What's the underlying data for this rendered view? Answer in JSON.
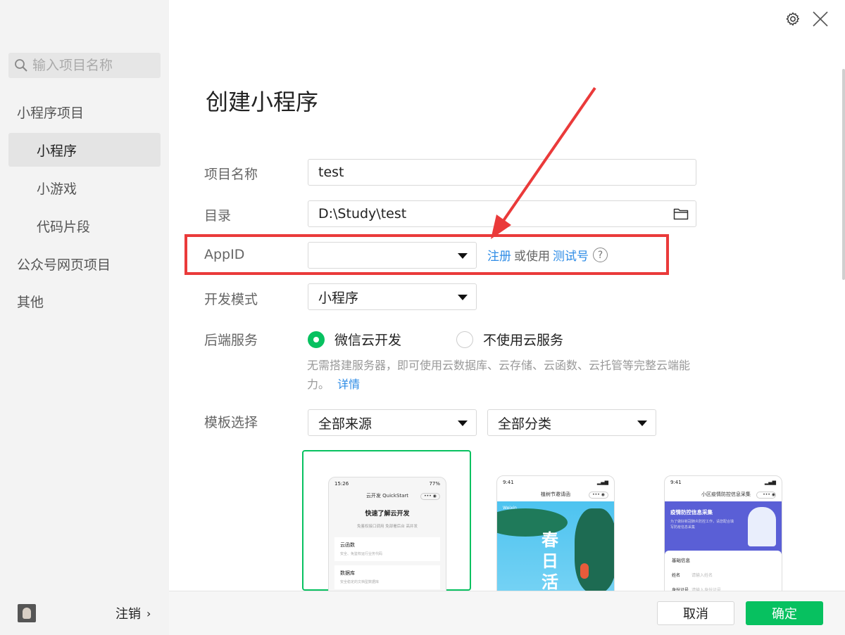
{
  "sidebar": {
    "search_placeholder": "输入项目名称",
    "items": [
      {
        "label": "小程序项目"
      },
      {
        "label": "小程序"
      },
      {
        "label": "小游戏"
      },
      {
        "label": "代码片段"
      },
      {
        "label": "公众号网页项目"
      },
      {
        "label": "其他"
      }
    ],
    "logout_label": "注销"
  },
  "form": {
    "title": "创建小程序",
    "project_name": {
      "label": "项目名称",
      "value": "test"
    },
    "directory": {
      "label": "目录",
      "value": "D:\\Study\\test"
    },
    "appid": {
      "label": "AppID",
      "value": "",
      "register_link": "注册",
      "or_use": "或使用",
      "test_link": "测试号",
      "help": "?"
    },
    "dev_mode": {
      "label": "开发模式",
      "value": "小程序"
    },
    "backend": {
      "label": "后端服务",
      "options": [
        {
          "label": "微信云开发",
          "selected": true
        },
        {
          "label": "不使用云服务",
          "selected": false
        }
      ],
      "description": "无需搭建服务器，即可使用云数据库、云存储、云函数、云托管等完整云端能力。",
      "detail_link": "详情"
    },
    "template": {
      "label": "模板选择",
      "source": "全部来源",
      "category": "全部分类"
    }
  },
  "templates": [
    {
      "time": "15:26",
      "battery": "77%",
      "header": "云开发 QuickStart",
      "heading": "快速了解云开发",
      "sub": "免鉴权接口调用 免部署后台 高并发",
      "rows": [
        {
          "title": "云函数",
          "desc": "安全、免鉴权运行业务代码"
        },
        {
          "title": "数据库",
          "desc": "安全稳定的文档型数据库"
        }
      ]
    },
    {
      "time": "9:41",
      "header": "植树节邀请函",
      "brand": "Weixin",
      "poster": "春日活"
    },
    {
      "time": "9:41",
      "header": "小区疫情防控信息采集",
      "banner_title": "疫情防控信息采集",
      "banner_text": "为了做好新冠肺炎防控工作，请您配合填写防疫信息采集",
      "section": "基础信息",
      "fields": [
        {
          "label": "姓名",
          "placeholder": "请输入姓名"
        },
        {
          "label": "身份证号",
          "placeholder": "请输入身份证号"
        }
      ]
    }
  ],
  "buttons": {
    "cancel": "取消",
    "confirm": "确定"
  },
  "colors": {
    "accent": "#07c160",
    "link": "#2e8ce6",
    "highlight": "#ea3a3a"
  }
}
